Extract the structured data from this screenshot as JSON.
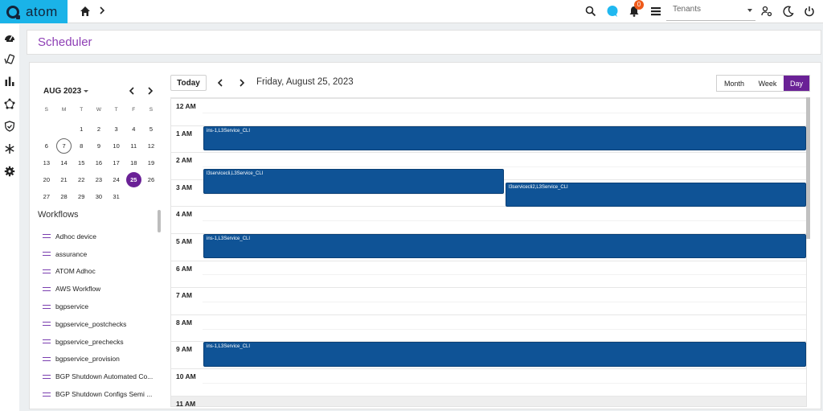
{
  "app": {
    "logo_text": "atom"
  },
  "topbar": {
    "notification_count": "0",
    "tenant_placeholder": "Tenants"
  },
  "header": {
    "title": "Scheduler"
  },
  "mini_calendar": {
    "month_label": "AUG 2023",
    "weekdays": [
      "S",
      "M",
      "T",
      "W",
      "T",
      "F",
      "S"
    ],
    "weeks": [
      [
        "",
        "",
        "1",
        "2",
        "3",
        "4",
        "5"
      ],
      [
        "6",
        "7",
        "8",
        "9",
        "10",
        "11",
        "12"
      ],
      [
        "13",
        "14",
        "15",
        "16",
        "17",
        "18",
        "19"
      ],
      [
        "20",
        "21",
        "22",
        "23",
        "24",
        "25",
        "26"
      ],
      [
        "27",
        "28",
        "29",
        "30",
        "31",
        "",
        ""
      ]
    ],
    "today": "7",
    "selected": "25"
  },
  "workflows": {
    "title": "Workflows",
    "items": [
      "Adhoc device",
      "assurance",
      "ATOM Adhoc",
      "AWS Workflow",
      "bgpservice",
      "bgpservice_postchecks",
      "bgpservice_prechecks",
      "bgpservice_provision",
      "BGP Shutdown Automated Co...",
      "BGP Shutdown Configs Semi ..."
    ]
  },
  "toolbar": {
    "today_label": "Today",
    "date_label": "Friday, August 25, 2023",
    "views": [
      "Month",
      "Week",
      "Day"
    ],
    "active_view": "Day"
  },
  "day_view": {
    "hours": [
      "12 AM",
      "1 AM",
      "2 AM",
      "3 AM",
      "4 AM",
      "5 AM",
      "6 AM",
      "7 AM",
      "8 AM",
      "9 AM",
      "10 AM",
      "11 AM"
    ],
    "events": [
      {
        "title": "ins-1,L3Service_CLI",
        "start": 1.0,
        "end": 1.9,
        "column": 0,
        "columns": 1
      },
      {
        "title": "l3servicecli,L3Service_CLI",
        "start": 2.6,
        "end": 3.5,
        "column": 0,
        "columns": 2
      },
      {
        "title": "l3servicecli2,L3Service_CLI",
        "start": 3.1,
        "end": 4.0,
        "column": 1,
        "columns": 2
      },
      {
        "title": "ins-1,L3Service_CLI",
        "start": 5.0,
        "end": 5.9,
        "column": 0,
        "columns": 1
      },
      {
        "title": "ins-1,L3Service_CLI",
        "start": 9.0,
        "end": 9.9,
        "column": 0,
        "columns": 1
      }
    ]
  }
}
